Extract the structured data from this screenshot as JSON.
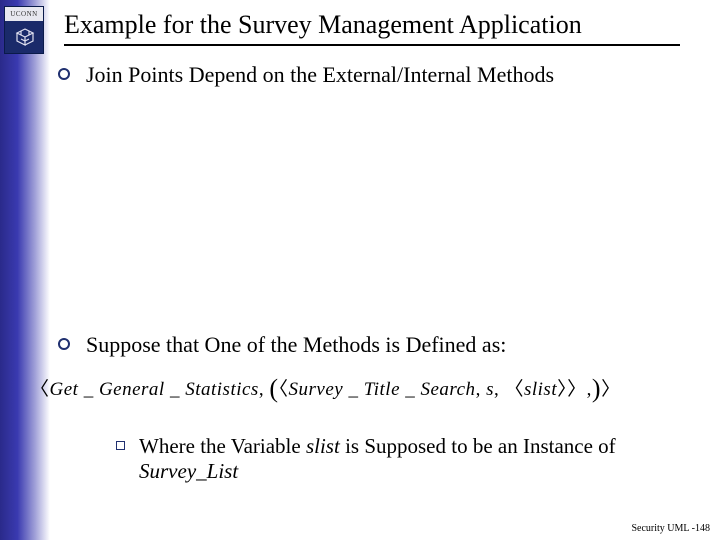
{
  "logo": {
    "text": "UCONN"
  },
  "title": "Example for the Survey Management Application",
  "bullets": {
    "b1": "Join Points Depend on the External/Internal Methods",
    "b2": "Suppose that One of the Methods is Defined as:"
  },
  "formula": {
    "outer_open": "〈",
    "term1": "Get _ General _ Statistics",
    "comma1": ", ",
    "paren_open": "(",
    "inner_open": "〈",
    "term2": "Survey _ Title _ Search",
    "comma2": ", ",
    "term3": "s",
    "comma3": ", ",
    "inner2_open": "〈",
    "term4": "slist",
    "inner2_close": "〉",
    "inner_close": "〉",
    "comma4": ",",
    "paren_close": ")",
    "outer_close": "〉"
  },
  "sub": {
    "pre": "Where the Variable ",
    "var1": "slist",
    "mid": " is Supposed to be an Instance of ",
    "var2": "Survey_List"
  },
  "footer": "Security UML -148"
}
